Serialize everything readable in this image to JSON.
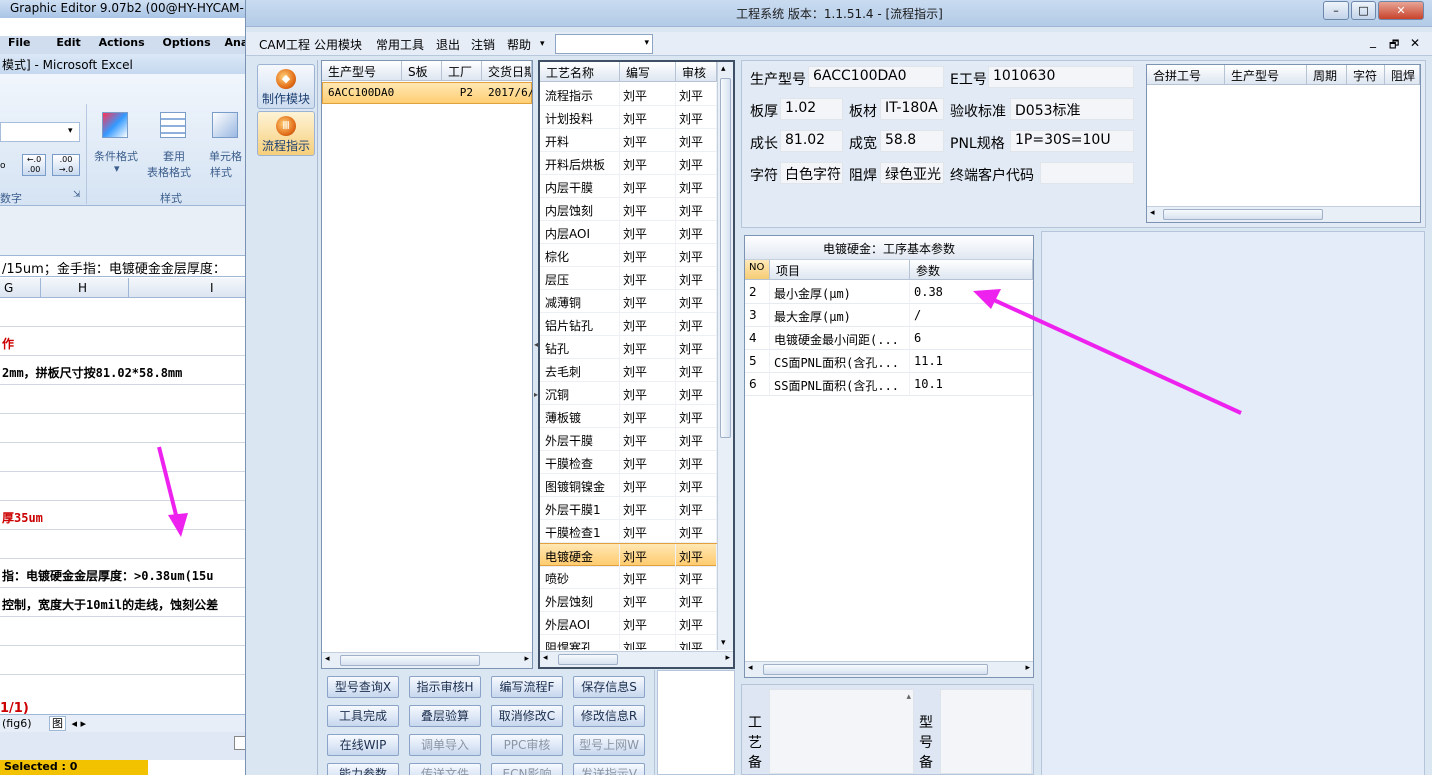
{
  "bg_app": {
    "graphic_editor_title": "Graphic Editor 9.07b2 (00@HY-HYCAM-",
    "menu": [
      "File",
      "Edit",
      "Actions",
      "Options",
      "Ana"
    ],
    "excel_title": "模式] - Microsoft Excel",
    "ribbon": {
      "cond_format": "条件格式",
      "table_format_1": "套用",
      "table_format_2": "表格格式",
      "cell_style_1": "单元格",
      "cell_style_2": "样式",
      "number_group": "数字",
      "style_group": "样式",
      "inc_decimal": "←.0\n.00",
      "dec_decimal": ".00\n→.0"
    },
    "formula_text": "/15um；金手指：电镀硬金金层厚度：",
    "columns": [
      "G",
      "H",
      "I"
    ],
    "rows": [
      {
        "text": "",
        "color": "#000000"
      },
      {
        "text": "作",
        "color": "#cc0000"
      },
      {
        "text": "2mm，拼板尺寸按81.02*58.8mm",
        "color": "#000000"
      },
      {
        "text": "",
        "color": "#000000"
      },
      {
        "text": "",
        "color": "#000000"
      },
      {
        "text": "",
        "color": "#000000"
      },
      {
        "text": "",
        "color": "#000000"
      },
      {
        "text": "厚35um",
        "color": "#cc0000"
      },
      {
        "text": "",
        "color": "#000000"
      },
      {
        "text": "指：电镀硬金金层厚度：>0.38um(15u",
        "color": "#000000"
      },
      {
        "text": "控制，宽度大于10mil的走线，蚀刻公差",
        "color": "#000000"
      },
      {
        "text": "",
        "color": "#000000"
      },
      {
        "text": "",
        "color": "#000000"
      }
    ],
    "page_text": "1/1)",
    "sheet_tabs": "(fig6)",
    "sheet_tab2": "图",
    "status": "Selected : 0"
  },
  "window": {
    "title": "工程系统  版本：1.1.51.4 - [流程指示]",
    "minimize": "–",
    "maximize": "□",
    "close": "✕",
    "menu": [
      "CAM工程",
      "公用模块",
      "常用工具",
      "退出",
      "注销",
      "帮助"
    ],
    "mdi_controls": [
      "_",
      "🗗",
      "✕"
    ]
  },
  "nav": [
    {
      "label": "制作模块",
      "icon": "make-module-icon"
    },
    {
      "label": "流程指示",
      "icon": "flow-guide-icon"
    }
  ],
  "order_grid": {
    "headers": [
      "生产型号",
      "S板",
      "工厂",
      "交货日期"
    ],
    "rows": [
      [
        "6ACC100DA0",
        "",
        "P2",
        "2017/6/"
      ]
    ]
  },
  "process_grid": {
    "headers": [
      "工艺名称",
      "编写",
      "审核"
    ],
    "rows": [
      [
        "流程指示",
        "刘平",
        "刘平"
      ],
      [
        "计划投料",
        "刘平",
        "刘平"
      ],
      [
        "开料",
        "刘平",
        "刘平"
      ],
      [
        "开料后烘板",
        "刘平",
        "刘平"
      ],
      [
        "内层干膜",
        "刘平",
        "刘平"
      ],
      [
        "内层蚀刻",
        "刘平",
        "刘平"
      ],
      [
        "内层AOI",
        "刘平",
        "刘平"
      ],
      [
        "棕化",
        "刘平",
        "刘平"
      ],
      [
        "层压",
        "刘平",
        "刘平"
      ],
      [
        "减薄铜",
        "刘平",
        "刘平"
      ],
      [
        "铝片钻孔",
        "刘平",
        "刘平"
      ],
      [
        "钻孔",
        "刘平",
        "刘平"
      ],
      [
        "去毛刺",
        "刘平",
        "刘平"
      ],
      [
        "沉铜",
        "刘平",
        "刘平"
      ],
      [
        "薄板镀",
        "刘平",
        "刘平"
      ],
      [
        "外层干膜",
        "刘平",
        "刘平"
      ],
      [
        "干膜检查",
        "刘平",
        "刘平"
      ],
      [
        "图镀铜镍金",
        "刘平",
        "刘平"
      ],
      [
        "外层干膜1",
        "刘平",
        "刘平"
      ],
      [
        "干膜检查1",
        "刘平",
        "刘平"
      ],
      [
        "电镀硬金",
        "刘平",
        "刘平"
      ],
      [
        "喷砂",
        "刘平",
        "刘平"
      ],
      [
        "外层蚀刻",
        "刘平",
        "刘平"
      ],
      [
        "外层AOI",
        "刘平",
        "刘平"
      ],
      [
        "阻焊塞孔",
        "刘平",
        "刘平"
      ]
    ],
    "selected_index": 20
  },
  "info": {
    "model_label": "生产型号",
    "model_value": "6ACC100DA0",
    "eno_label": "E工号",
    "eno_value": "1010630",
    "thickness_label": "板厚",
    "thickness_value": "1.02",
    "material_label": "板材",
    "material_value": "IT-180A",
    "standard_label": "验收标准",
    "standard_value": "D053标准",
    "length_label": "成长",
    "length_value": "81.02",
    "width_label": "成宽",
    "width_value": "58.8",
    "pnl_label": "PNL规格",
    "pnl_value": "1P=30S=10U",
    "char_label": "字符",
    "char_value": "白色字符",
    "mask_label": "阻焊",
    "mask_value": "绿色亚光",
    "customer_label": "终端客户代码",
    "customer_value": ""
  },
  "combine_grid": {
    "headers": [
      "合拼工号",
      "生产型号",
      "周期",
      "字符",
      "阻焊"
    ]
  },
  "param_grid": {
    "title": "电镀硬金：工序基本参数",
    "headers": [
      "NO",
      "项目",
      "参数"
    ],
    "rows": [
      [
        "2",
        "最小金厚(μm)",
        "0.38"
      ],
      [
        "3",
        "最大金厚(μm)",
        "/"
      ],
      [
        "4",
        "电镀硬金最小间距(...",
        "6"
      ],
      [
        "5",
        "CS面PNL面积(含孔...",
        "11.1"
      ],
      [
        "6",
        "SS面PNL面积(含孔...",
        "10.1"
      ]
    ]
  },
  "buttons": [
    {
      "label": "型号查询X",
      "enabled": true
    },
    {
      "label": "指示审核H",
      "enabled": true
    },
    {
      "label": "编写流程F",
      "enabled": true
    },
    {
      "label": "保存信息S",
      "enabled": true
    },
    {
      "label": "工具完成",
      "enabled": true
    },
    {
      "label": "叠层验算",
      "enabled": true
    },
    {
      "label": "取消修改C",
      "enabled": true
    },
    {
      "label": "修改信息R",
      "enabled": true
    },
    {
      "label": "在线WIP",
      "enabled": true
    },
    {
      "label": "调单导入",
      "enabled": false
    },
    {
      "label": "PPC审核",
      "enabled": false
    },
    {
      "label": "型号上网W",
      "enabled": false
    },
    {
      "label": "能力参数",
      "enabled": true
    },
    {
      "label": "传送文件",
      "enabled": false
    },
    {
      "label": "ECN影响",
      "enabled": false
    },
    {
      "label": "发送指示V",
      "enabled": false
    }
  ],
  "remarks": {
    "process_note_label": "工\n艺\n备",
    "model_note_label": "型\n号\n备"
  },
  "colors": {
    "annotation_arrow": "#ee22ee",
    "selected_row": "#ffd27f"
  }
}
